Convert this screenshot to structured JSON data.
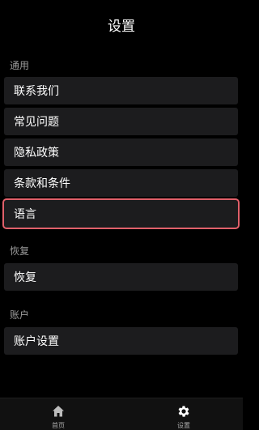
{
  "header": {
    "title": "设置"
  },
  "sections": {
    "general": {
      "label": "通用",
      "items": [
        "联系我们",
        "常见问题",
        "隐私政策",
        "条款和条件",
        "语言"
      ]
    },
    "restore": {
      "label": "恢复",
      "items": [
        "恢复"
      ]
    },
    "account": {
      "label": "账户",
      "items": [
        "账户设置"
      ]
    }
  },
  "tabbar": {
    "home": {
      "label": "首页",
      "icon": "home-icon"
    },
    "settings": {
      "label": "设置",
      "icon": "gear-icon"
    }
  },
  "colors": {
    "highlight": "#e0606a",
    "item_bg": "#1c1c1e"
  }
}
